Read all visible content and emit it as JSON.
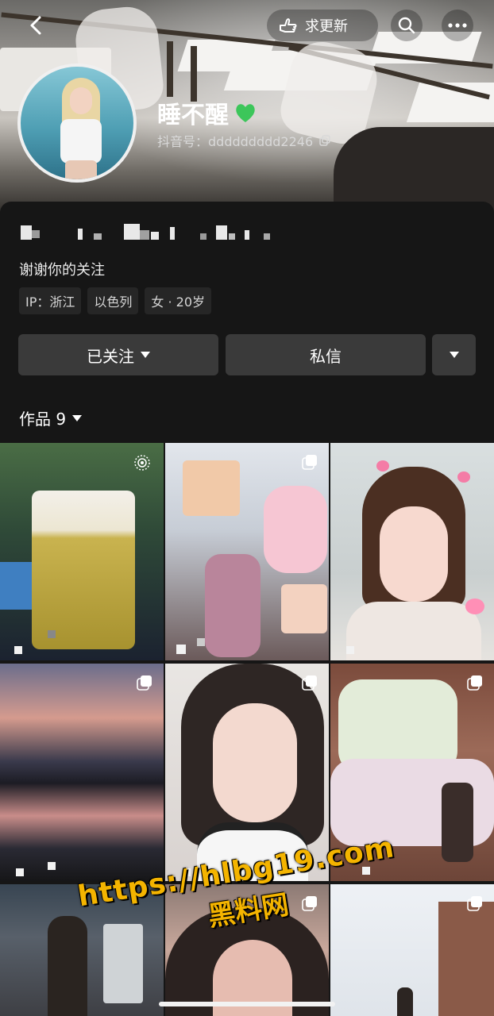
{
  "header": {
    "request_update_label": "求更新"
  },
  "profile": {
    "nickname": "睡不醒",
    "douyin_id": "抖音号：ddddddddd2246",
    "bio": "谢谢你的关注",
    "tags": [
      "IP：浙江",
      "以色列",
      "女 · 20岁"
    ]
  },
  "actions": {
    "follow_label": "已关注",
    "message_label": "私信"
  },
  "works": {
    "label": "作品 9"
  },
  "watermark": {
    "url": "https://hlbg19.com",
    "site": "黑料网"
  },
  "colors": {
    "background": "#161616",
    "button": "#3a3a3a",
    "tag": "#262626",
    "heart": "#3cc65a",
    "watermark": "#f4b400"
  }
}
